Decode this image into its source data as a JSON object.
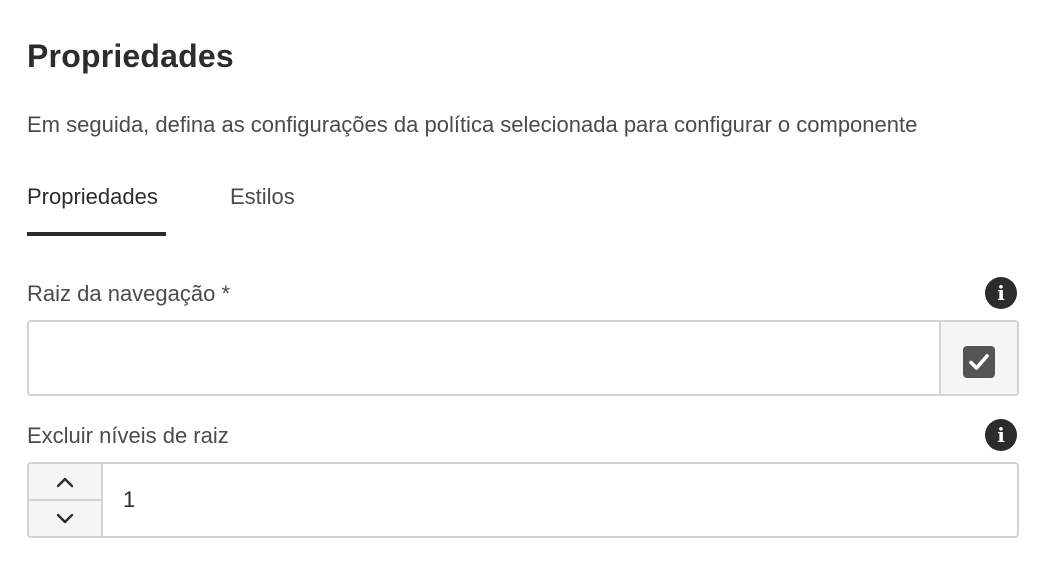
{
  "header": {
    "title": "Propriedades",
    "subtitle": "Em seguida, defina as configurações da política selecionada para configurar o componente"
  },
  "tabs": [
    {
      "label": "Propriedades",
      "active": true
    },
    {
      "label": "Estilos",
      "active": false
    }
  ],
  "fields": {
    "navigation_root": {
      "label": "Raiz da navegação *",
      "value": "",
      "picker_icon": "check-square-icon",
      "info_icon": "info-icon"
    },
    "exclude_root_levels": {
      "label": "Excluir níveis de raiz",
      "value": "1",
      "increment_icon": "chevron-up-icon",
      "decrement_icon": "chevron-down-icon",
      "info_icon": "info-icon"
    }
  },
  "icons": {
    "info_glyph": "i"
  },
  "colors": {
    "text": "#2c2c2c",
    "muted_text": "#4b4b4b",
    "border": "#d3d3d3",
    "button_bg": "#f5f5f5",
    "picker_icon_bg": "#555555"
  }
}
